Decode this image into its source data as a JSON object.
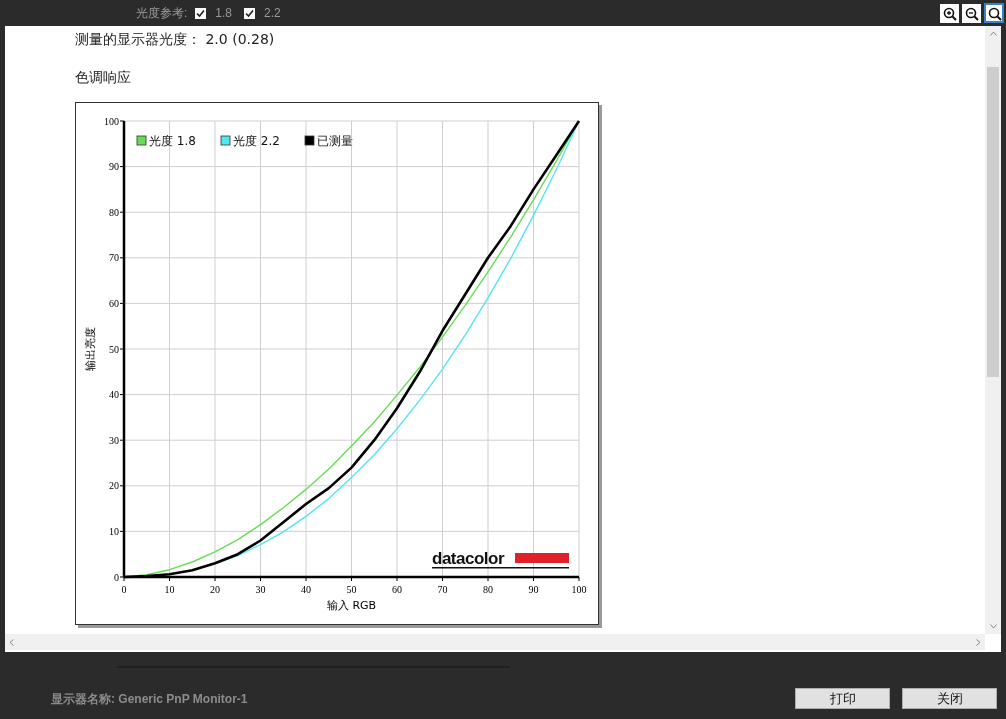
{
  "toolbar": {
    "reference_label": "光度参考:",
    "references": [
      {
        "label": "1.8",
        "checked": true
      },
      {
        "label": "2.2",
        "checked": true
      }
    ],
    "zoom_tools": [
      {
        "kind": "zoom-in",
        "selected": false
      },
      {
        "kind": "zoom-out",
        "selected": false
      },
      {
        "kind": "zoom-fit",
        "selected": true
      }
    ]
  },
  "report": {
    "measured_gamma": "测量的显示器光度： 2.0 (0.28)",
    "section_title": "色调响应",
    "chart_data": {
      "type": "line",
      "xlabel": "输入 RGB",
      "ylabel": "输出亮度",
      "x": [
        0,
        5,
        10,
        15,
        20,
        25,
        30,
        35,
        40,
        45,
        50,
        55,
        60,
        65,
        70,
        75,
        80,
        85,
        90,
        95,
        100
      ],
      "series": [
        {
          "name": "光度 1.8",
          "color": "#66dd55",
          "values": [
            0,
            0.5,
            1.6,
            3.3,
            5.5,
            8.2,
            11.5,
            15.2,
            19.2,
            23.7,
            28.7,
            34.0,
            39.9,
            46.0,
            52.6,
            59.6,
            66.9,
            74.6,
            82.7,
            91.2,
            100
          ]
        },
        {
          "name": "光度 2.2",
          "color": "#55e5f0",
          "values": [
            null,
            null,
            null,
            null,
            2.9,
            4.7,
            7.1,
            9.9,
            13.3,
            17.2,
            21.8,
            26.8,
            32.5,
            38.8,
            45.6,
            53.1,
            61.2,
            69.9,
            79.3,
            89.3,
            100
          ]
        },
        {
          "name": "已测量",
          "color": "#000000",
          "values": [
            0,
            0.2,
            0.6,
            1.5,
            3,
            5,
            8,
            12,
            16,
            19.5,
            24,
            30,
            37,
            45,
            54,
            62,
            70,
            77,
            85,
            92.5,
            100
          ]
        }
      ],
      "grid": true,
      "legend": true,
      "xlim": [
        0,
        100
      ],
      "ylim": [
        0,
        100
      ],
      "xticks": [
        0,
        10,
        20,
        30,
        40,
        50,
        60,
        70,
        80,
        90,
        100
      ],
      "yticks": [
        0,
        10,
        20,
        30,
        40,
        50,
        60,
        70,
        80,
        90,
        100
      ]
    },
    "logo": "datacolor"
  },
  "footer": {
    "display_name": "显示器名称: Generic PnP Monitor-1",
    "buttons": [
      "打印",
      "关闭"
    ]
  }
}
